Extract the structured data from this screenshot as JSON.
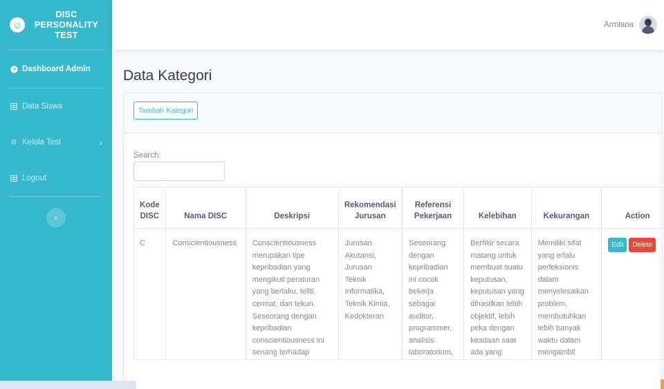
{
  "brand": {
    "line1": "DISC",
    "line2": "PERSONALITY",
    "line3": "TEST",
    "logo_icon": "laugh-wink-icon"
  },
  "sidebar": {
    "items": [
      {
        "label": "Dashboard Admin",
        "icon": "tachometer-icon",
        "active": true
      },
      {
        "label": "Data Siswa",
        "icon": "table-icon",
        "active": false
      },
      {
        "label": "Kelola Test",
        "icon": "cog-icon",
        "active": false,
        "has_submenu": true
      },
      {
        "label": "Logout",
        "icon": "table-icon",
        "active": false
      }
    ],
    "toggle_icon": "chevron-left-icon"
  },
  "topbar": {
    "user_name": "Armiana"
  },
  "page": {
    "title": "Data Kategori"
  },
  "card": {
    "add_button": "Tambah Kategori"
  },
  "search": {
    "label": "Search:",
    "value": ""
  },
  "table": {
    "columns": [
      "Kode DISC",
      "Nama DISC",
      "Deskripsi",
      "Rekomendasi Jurusan",
      "Referensi Pekerjaan",
      "Kelebihan",
      "Kekurangan",
      "Action"
    ],
    "rows": [
      {
        "kode": "C",
        "nama": "Conscientiousness",
        "deskripsi": [
          "Conscientiousness",
          "merupakan tipe",
          "kepribadian yang",
          "mengikuti peraturan",
          "yang berlaku, teliti,",
          "cermat, dan tekun.",
          "Seseorang dengan",
          "kepribadian",
          "conscientiousness ini",
          "senang terhadap"
        ],
        "rekomendasi": [
          "Jurusan",
          "Akutansi,",
          "Jurusan",
          "Teknik",
          "Informatika,",
          "Teknik Kimia,",
          "Kedokteran"
        ],
        "referensi": [
          "Seseorang",
          "dengan",
          "kepribadian",
          "ini cocok",
          "bekerja",
          "sebagai",
          "auditor,",
          "programmer,",
          "analisis",
          "laboratorium,"
        ],
        "kelebihan": [
          "Berfikir secara",
          "matang untuk",
          "membuat suatu",
          "keputusan,",
          "keputusan yang",
          "dihasilkan lebih",
          "objektif, lebih",
          "peka dengan",
          "keadaan saat",
          "ada yang"
        ],
        "kekurangan": [
          "Memiliki sifat",
          "yang erlalu",
          "perfeksionis",
          "dalam",
          "menyelesaikan",
          "problem,",
          "membutuhkan",
          "lebih banyak",
          "waktu dalam",
          "mengambil"
        ],
        "edit_label": "Edit",
        "delete_label": "Delete"
      }
    ]
  },
  "colors": {
    "sidebar": "#36b9cc",
    "edit": "#36b9cc",
    "delete": "#e74a3b"
  }
}
